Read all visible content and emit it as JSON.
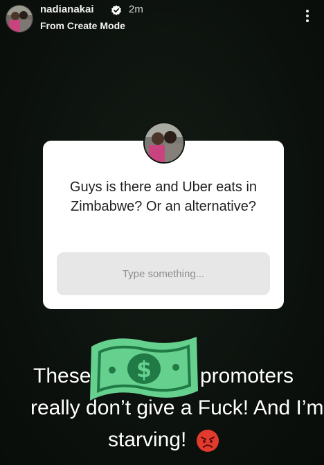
{
  "header": {
    "username": "nadianakai",
    "time_ago": "2m",
    "subtitle": "From Create Mode"
  },
  "question_card": {
    "question": "Guys is there and Uber eats in Zimbabwe? Or an alternative?",
    "input_placeholder": "Type something..."
  },
  "caption": {
    "line1_start": "These",
    "line1_end": "promoters",
    "line2": "really don’t give a Fuck! And I’m",
    "line3": "starving!"
  },
  "icons": {
    "verified": "verified-badge-icon",
    "more": "more-options-icon",
    "sticker": "money-bill-sticker-icon",
    "emoji": "angry-face-emoji-icon"
  },
  "colors": {
    "background": "#0d130e",
    "card": "#ffffff",
    "input": "#e7e7e7",
    "money_green": "#5fd08a"
  }
}
